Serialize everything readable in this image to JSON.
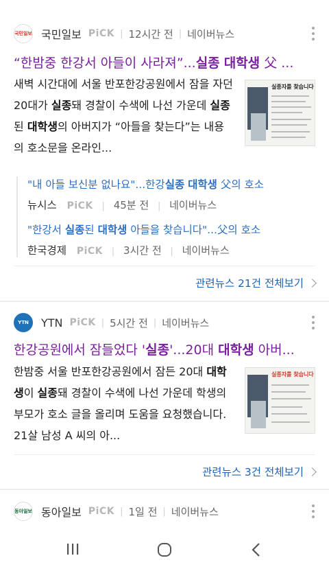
{
  "colors": {
    "title": "#7a1ea0",
    "related": "#2a6fc4",
    "more": "#1e62b8",
    "meta": "#666666",
    "pick": "#b6b6b6"
  },
  "articles": [
    {
      "press": "국민일보",
      "logo_text": "국민일보",
      "pick": "PiCK",
      "time": "12시간 전",
      "source": "네이버뉴스",
      "title": "“한밤중 한강서 아들이 사라져”...실종 대학생 父 ...",
      "body": "새벽 시간대에 서울 반포한강공원에서 잠을 자던 20대가 실종돼 경찰이 수색에 나선 가운데 실종된 대학생의 아버지가 “아들을 찾는다”는 내용의 호소문을 온라인...",
      "thumb_title": "실종자를 찾습니다",
      "related": [
        {
          "title": "\"내 아들 보신분 없나요\"...한강실종 대학생 父의 호소",
          "press": "뉴시스",
          "pick": "PiCK",
          "time": "45분 전",
          "source": "네이버뉴스"
        },
        {
          "title": "\"한강서 실종된 대학생 아들을 찾습니다\"...父의 호소",
          "press": "한국경제",
          "pick": "PiCK",
          "time": "3시간 전",
          "source": "네이버뉴스"
        }
      ],
      "more": "관련뉴스 21건 전체보기"
    },
    {
      "press": "YTN",
      "logo_text": "YTN",
      "pick": "PiCK",
      "time": "5시간 전",
      "source": "네이버뉴스",
      "title": "한강공원에서 잠들었다 '실종'...20대 대학생 아버...",
      "body": "한밤중 서울 반포한강공원에서 잠든 20대 대학생이 실종돼 경찰이 수색에 나선 가운데 학생의 부모가 호소 글을 올리며 도움을 요청했습니다. 21살 남성 A 씨의 아...",
      "thumb_title": "실종자를 찾습니다",
      "more": "관련뉴스 3건 전체보기"
    },
    {
      "press": "동아일보",
      "logo_text": "동아일보",
      "pick": "PiCK",
      "time": "1일 전",
      "source": "네이버뉴스"
    }
  ],
  "nav": {
    "recent": "recent-apps-icon",
    "home": "home-icon",
    "back": "back-icon"
  }
}
